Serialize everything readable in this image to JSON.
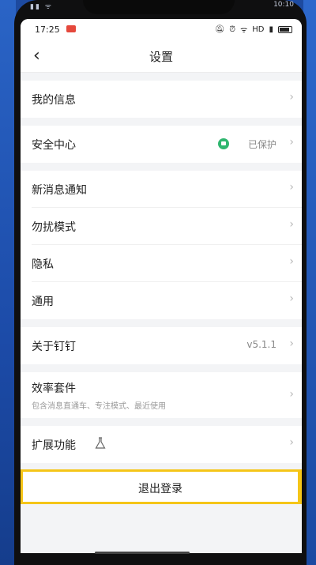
{
  "outer_status": {
    "signal": "▮▮ ᯤ",
    "time": "10:10"
  },
  "status": {
    "clock": "17:25",
    "network": "HD"
  },
  "nav": {
    "title": "设置",
    "back_icon": "chevron-left-icon"
  },
  "groups": {
    "my_info": {
      "label": "我的信息"
    },
    "security": {
      "label": "安全中心",
      "value": "已保护"
    },
    "notify": {
      "label": "新消息通知"
    },
    "dnd": {
      "label": "勿扰模式"
    },
    "privacy": {
      "label": "隐私"
    },
    "general": {
      "label": "通用"
    },
    "about": {
      "label": "关于钉钉",
      "value": "v5.1.1"
    },
    "efficiency": {
      "label": "效率套件",
      "sub": "包含消息直通车、专注模式、最近使用"
    },
    "extensions": {
      "label": "扩展功能"
    }
  },
  "logout": {
    "label": "退出登录"
  },
  "colors": {
    "accent": "#2fb66f",
    "highlight": "#f5c518"
  }
}
